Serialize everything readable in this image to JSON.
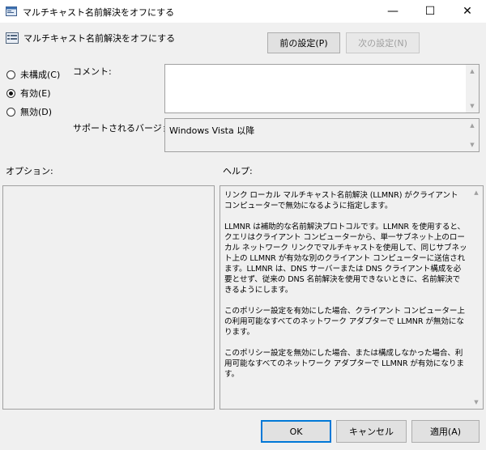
{
  "window": {
    "title": "マルチキャスト名前解決をオフにする",
    "minimize": "—",
    "maximize": "☐",
    "close": "✕"
  },
  "heading": "マルチキャスト名前解決をオフにする",
  "nav": {
    "prev_label": "前の設定(P)",
    "next_label": "次の設定(N)"
  },
  "state": {
    "options": [
      {
        "label": "未構成(C)",
        "selected": false
      },
      {
        "label": "有効(E)",
        "selected": true
      },
      {
        "label": "無効(D)",
        "selected": false
      }
    ]
  },
  "comment": {
    "label": "コメント:",
    "value": ""
  },
  "supported": {
    "label": "サポートされるバージョン:",
    "value": "Windows Vista 以降"
  },
  "options_label": "オプション:",
  "help_label": "ヘルプ:",
  "help_paragraphs": [
    "リンク ローカル マルチキャスト名前解決 (LLMNR) がクライアント コンピューターで無効になるように指定します。",
    "LLMNR は補助的な名前解決プロトコルです。LLMNR を使用すると、クエリはクライアント コンピューターから、単一サブネット上のローカル ネットワーク リンクでマルチキャストを使用して、同じサブネット上の LLMNR が有効な別のクライアント コンピューターに送信されます。LLMNR は、DNS サーバーまたは DNS クライアント構成を必要とせず、従来の DNS 名前解決を使用できないときに、名前解決できるようにします。",
    "このポリシー設定を有効にした場合、クライアント コンピューター上の利用可能なすべてのネットワーク アダプターで LLMNR が無効になります。",
    "このポリシー設定を無効にした場合、または構成しなかった場合、利用可能なすべてのネットワーク アダプターで LLMNR が有効になります。"
  ],
  "footer": {
    "ok": "OK",
    "cancel": "キャンセル",
    "apply": "適用(A)"
  },
  "colors": {
    "accent": "#0078d7",
    "window_bg": "#f0f0f0",
    "titlebar_bg": "#ffffff"
  }
}
